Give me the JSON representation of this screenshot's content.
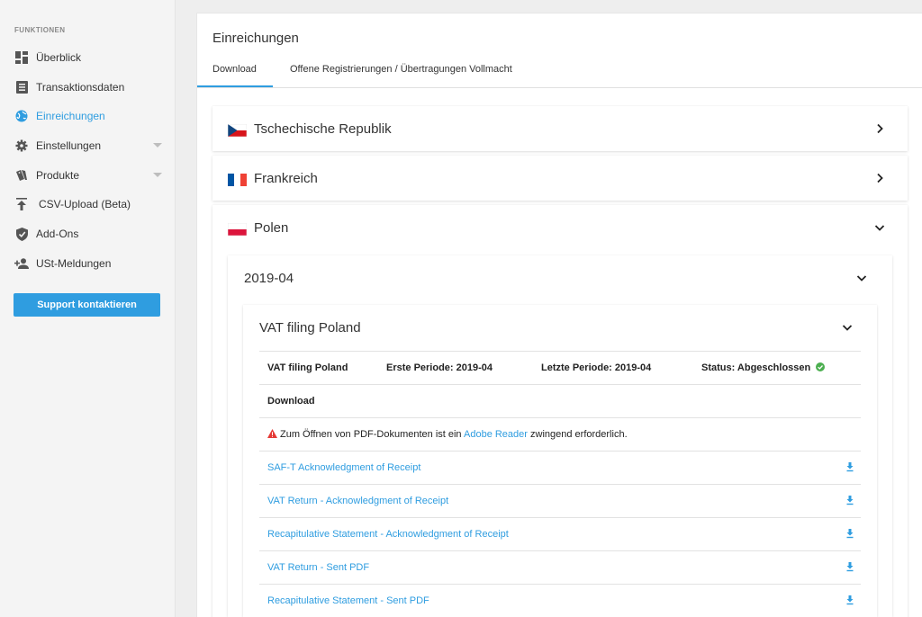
{
  "sidebar": {
    "heading": "FUNKTIONEN",
    "items": [
      {
        "label": "Überblick",
        "icon": "dashboard-icon"
      },
      {
        "label": "Transaktionsdaten",
        "icon": "list-icon"
      },
      {
        "label": "Einreichungen",
        "icon": "globe-icon",
        "active": true
      },
      {
        "label": "Einstellungen",
        "icon": "gear-icon",
        "dropdown": true
      },
      {
        "label": "Produkte",
        "icon": "tags-icon",
        "dropdown": true
      },
      {
        "label": "CSV-Upload (Beta)",
        "icon": "upload-icon"
      },
      {
        "label": "Add-Ons",
        "icon": "shield-icon"
      },
      {
        "label": "USt-Meldungen",
        "icon": "add-person-icon"
      }
    ],
    "support_button": "Support kontaktieren"
  },
  "main": {
    "title": "Einreichungen",
    "tabs": [
      {
        "label": "Download",
        "active": true
      },
      {
        "label": "Offene Registrierungen / Übertragungen Vollmacht"
      }
    ],
    "countries": [
      {
        "name": "Tschechische Republik",
        "expanded": false
      },
      {
        "name": "Frankreich",
        "expanded": false
      },
      {
        "name": "Polen",
        "expanded": true
      }
    ],
    "period": {
      "label": "2019-04",
      "filing": {
        "title": "VAT filing Poland",
        "summary": {
          "name": "VAT filing Poland",
          "first_period": "Erste Periode: 2019-04",
          "last_period": "Letzte Periode: 2019-04",
          "status": "Status: Abgeschlossen"
        },
        "download_heading": "Download",
        "notice": {
          "before": "Zum Öffnen von PDF-Dokumenten ist ein ",
          "link": "Adobe Reader",
          "after": " zwingend erforderlich."
        },
        "documents": [
          "SAF-T Acknowledgment of Receipt",
          "VAT Return - Acknowledgment of Receipt",
          "Recapitulative Statement - Acknowledgment of Receipt",
          "VAT Return - Sent PDF",
          "Recapitulative Statement - Sent PDF"
        ]
      }
    }
  },
  "colors": {
    "accent": "#2f9de0",
    "success": "#4caf50",
    "warning": "#e53935"
  }
}
